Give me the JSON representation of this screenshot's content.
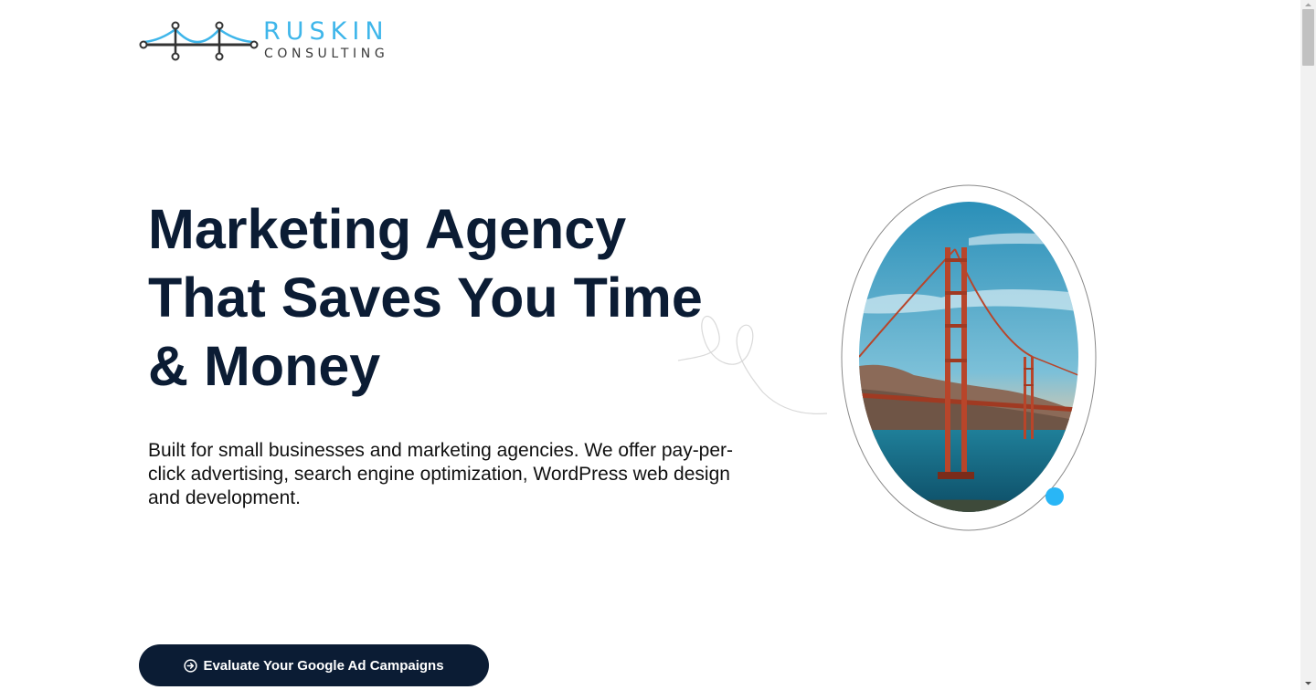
{
  "brand": {
    "name": "RUSKIN",
    "tagline": "CONSULTING",
    "accent_color": "#3fb6ea",
    "icon": "bridge-logo-icon"
  },
  "hero": {
    "title_lines": [
      "Marketing Agency",
      "That Saves You Time",
      "& Money"
    ],
    "description": "Built for small businesses and marketing agencies. We offer pay-per-click advertising, search engine optimization, WordPress web design and development.",
    "image": "golden-gate-bridge-photo"
  },
  "cta": {
    "label": "Evaluate Your Google Ad Campaigns",
    "icon": "arrow-circle-right-icon",
    "color": "#0b1c34"
  },
  "colors": {
    "heading": "#0b1c34",
    "dot": "#29b6f6"
  }
}
